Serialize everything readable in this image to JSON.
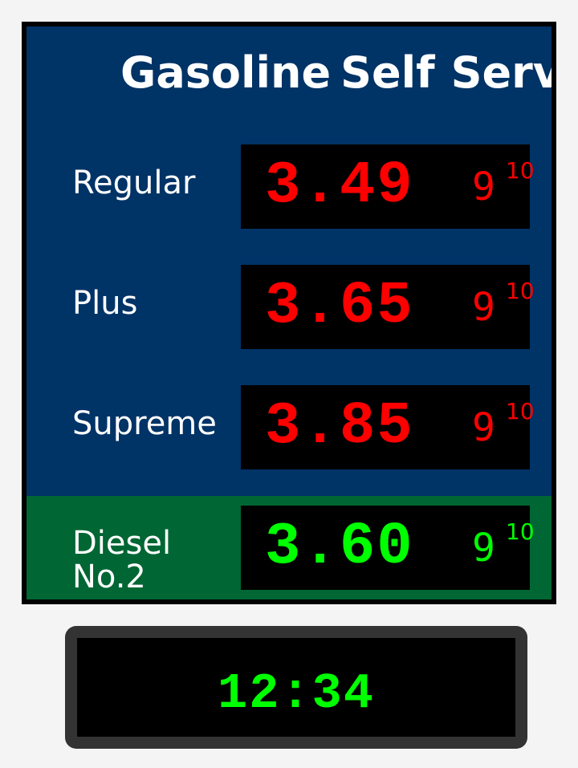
{
  "sign": {
    "title_words": [
      "Gasoline",
      "Self",
      "Serve"
    ],
    "grades": [
      {
        "label": "Regular",
        "price": "3.49",
        "fraction_numerator": "9",
        "fraction_denominator": "10"
      },
      {
        "label": "Plus",
        "price": "3.65",
        "fraction_numerator": "9",
        "fraction_denominator": "10"
      },
      {
        "label": "Supreme",
        "price": "3.85",
        "fraction_numerator": "9",
        "fraction_denominator": "10"
      }
    ],
    "diesel": {
      "label_line1": "Diesel",
      "label_line2": "No.2",
      "price": "3.60",
      "fraction_numerator": "9",
      "fraction_denominator": "10"
    }
  },
  "clock": {
    "time": "12:34"
  },
  "colors": {
    "gasoline_panel": "#003366",
    "diesel_panel": "#006633",
    "gasoline_digits": "#ff0000",
    "diesel_digits": "#00ff00",
    "clock_digits": "#00ff00",
    "frame": "#000000",
    "clock_bezel": "#333333",
    "background": "#f4f4f4"
  }
}
